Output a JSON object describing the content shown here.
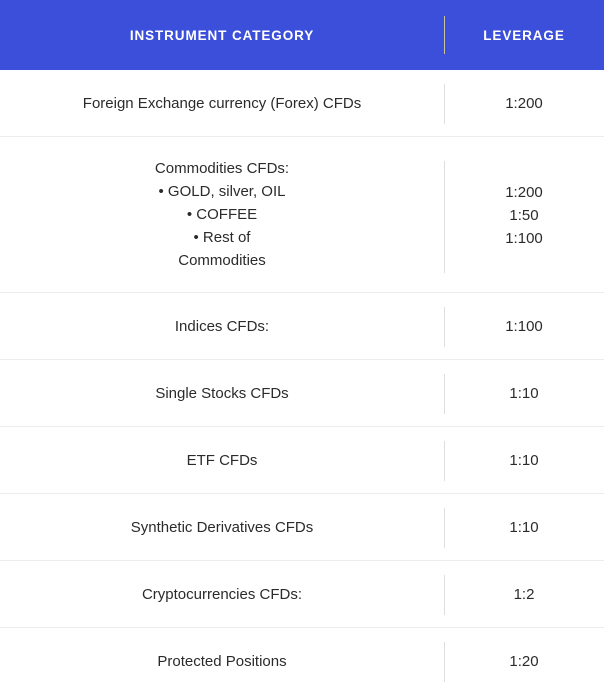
{
  "table": {
    "header": {
      "category_label": "INSTRUMENT CATEGORY",
      "leverage_label": "LEVERAGE",
      "background_color": "#3b4fdb",
      "text_color": "#ffffff",
      "divider_color": "#c7c4a2"
    },
    "colors": {
      "row_background": "#ffffff",
      "row_separator": "#ececec",
      "row_divider": "#dedede",
      "body_text": "#2b2b2b"
    },
    "rows": [
      {
        "category_lines": [
          "Foreign Exchange currency (Forex) CFDs"
        ],
        "leverage_lines": [
          "1:200"
        ]
      },
      {
        "category_lines": [
          "Commodities CFDs:",
          "• GOLD, silver, OIL",
          "• COFFEE",
          "• Rest of",
          "Commodities"
        ],
        "leverage_lines": [
          "1:200",
          "1:50",
          "1:100"
        ]
      },
      {
        "category_lines": [
          "Indices CFDs:"
        ],
        "leverage_lines": [
          "1:100"
        ]
      },
      {
        "category_lines": [
          "Single Stocks CFDs"
        ],
        "leverage_lines": [
          "1:10"
        ]
      },
      {
        "category_lines": [
          "ETF CFDs"
        ],
        "leverage_lines": [
          "1:10"
        ]
      },
      {
        "category_lines": [
          "Synthetic Derivatives CFDs"
        ],
        "leverage_lines": [
          "1:10"
        ]
      },
      {
        "category_lines": [
          "Cryptocurrencies CFDs:"
        ],
        "leverage_lines": [
          "1:2"
        ]
      },
      {
        "category_lines": [
          "Protected Positions"
        ],
        "leverage_lines": [
          "1:20"
        ]
      }
    ]
  }
}
